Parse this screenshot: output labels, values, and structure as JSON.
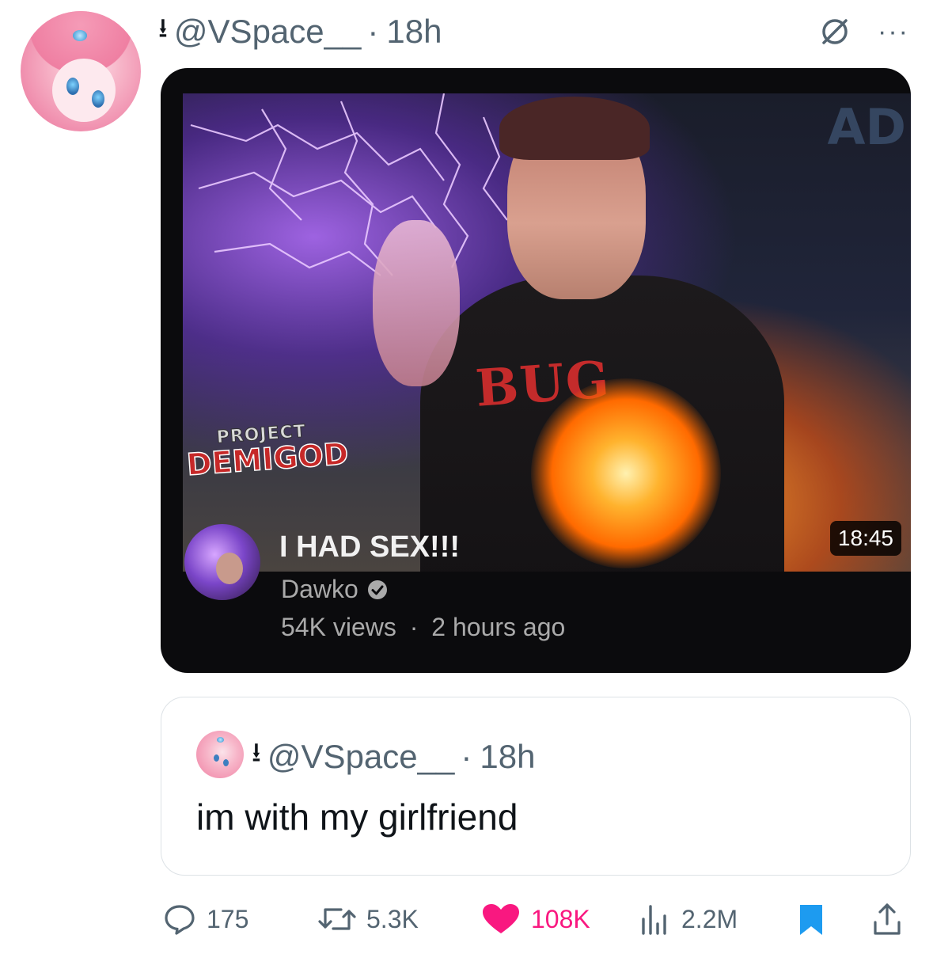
{
  "tweet": {
    "pin_glyph": "⭳",
    "handle": "@VSpace__",
    "separator": "·",
    "time": "18h",
    "more_glyph": "···"
  },
  "media": {
    "thumbnail": {
      "ad_mark": "AD",
      "logo_top": "PROJECT",
      "logo_bottom": "DEMIGOD",
      "shirt_text": "BUG",
      "duration": "18:45"
    },
    "video_title": "I HAD SEX!!!",
    "channel_name": "Dawko",
    "views": "54K views",
    "meta_separator": "·",
    "posted": "2 hours ago"
  },
  "quote": {
    "pin_glyph": "⭳",
    "handle": "@VSpace__",
    "separator": "·",
    "time": "18h",
    "text": "im with my girlfriend"
  },
  "actions": {
    "replies": "175",
    "reposts": "5.3K",
    "likes": "108K",
    "views": "2.2M",
    "like_color": "#f91880",
    "bookmark_color": "#1d9bf0"
  }
}
